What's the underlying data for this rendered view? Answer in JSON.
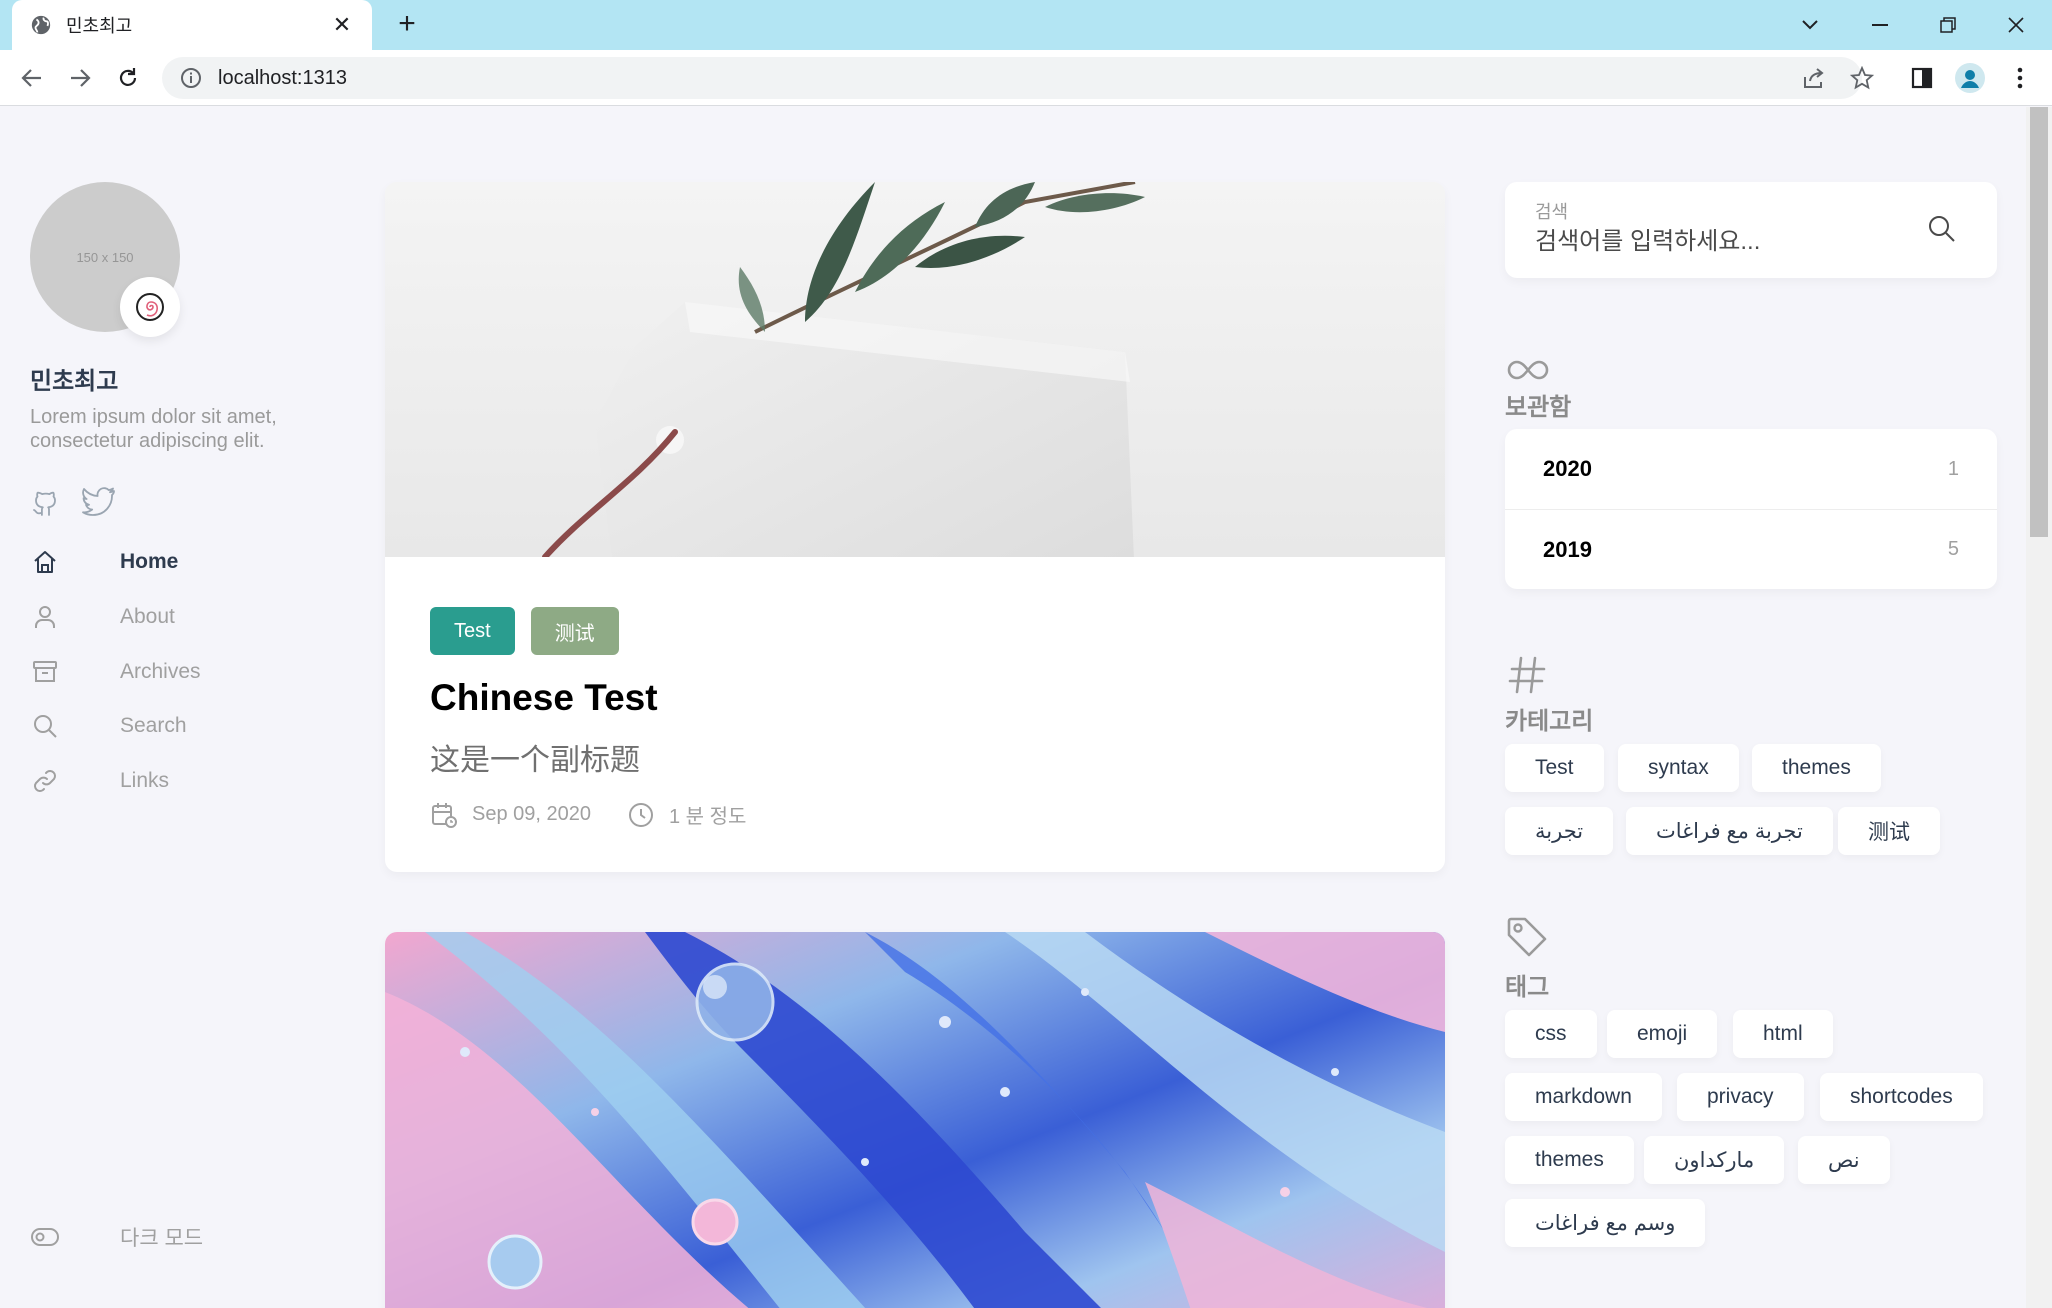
{
  "browser": {
    "tab_title": "민초최고",
    "url": "localhost:1313"
  },
  "sidebar": {
    "avatar_placeholder": "150 x 150",
    "site_name": "민초최고",
    "site_description": "Lorem ipsum dolor sit amet, consectetur adipiscing elit.",
    "menu": [
      {
        "label": "Home",
        "icon": "home-icon",
        "active": true
      },
      {
        "label": "About",
        "icon": "user-icon",
        "active": false
      },
      {
        "label": "Archives",
        "icon": "archive-icon",
        "active": false
      },
      {
        "label": "Search",
        "icon": "search-icon",
        "active": false
      },
      {
        "label": "Links",
        "icon": "link-icon",
        "active": false
      }
    ],
    "dark_mode_label": "다크 모드"
  },
  "articles": [
    {
      "categories": [
        {
          "label": "Test",
          "color": "#2a9d8f"
        },
        {
          "label": "测试",
          "color": "#8eaa85"
        }
      ],
      "title": "Chinese Test",
      "subtitle": "这是一个副标题",
      "date": "Sep 09, 2020",
      "reading_time": "1 분 정도"
    }
  ],
  "widgets": {
    "search": {
      "label": "검색",
      "placeholder": "검색어를 입력하세요..."
    },
    "archives": {
      "title": "보관함",
      "items": [
        {
          "year": "2020",
          "count": "1"
        },
        {
          "year": "2019",
          "count": "5"
        }
      ]
    },
    "categories": {
      "title": "카테고리",
      "items": [
        "Test",
        "syntax",
        "themes",
        "تجربة",
        "تجربة مع فراغات",
        "测试"
      ]
    },
    "tags": {
      "title": "태그",
      "items": [
        "css",
        "emoji",
        "html",
        "markdown",
        "privacy",
        "shortcodes",
        "themes",
        "ماركداون",
        "نص",
        "وسم مع فراغات"
      ]
    }
  },
  "colors": {
    "accent": "#2a9d8f",
    "page_background": "#f5f5fa",
    "tab_strip": "#b3e5f3"
  }
}
